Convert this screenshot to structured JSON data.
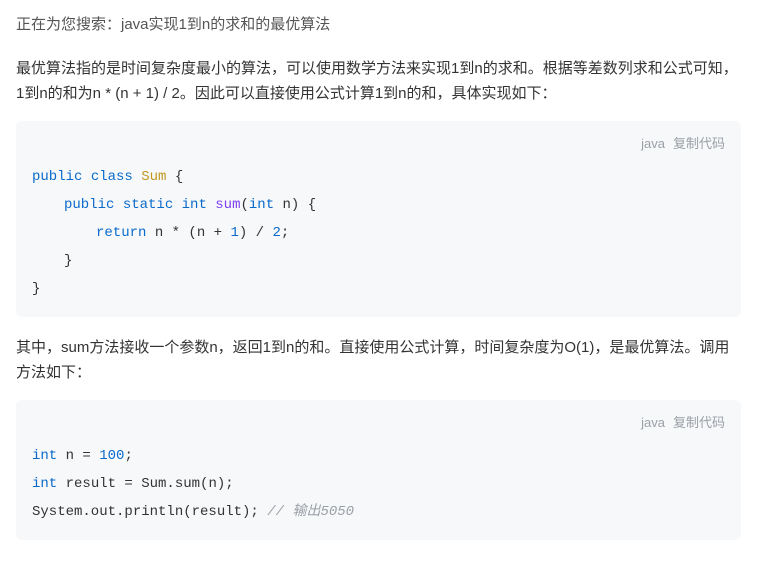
{
  "search_status": "正在为您搜索：java实现1到n的求和的最优算法",
  "para1": "最优算法指的是时间复杂度最小的算法，可以使用数学方法来实现1到n的求和。根据等差数列求和公式可知，1到n的和为n * (n + 1) / 2。因此可以直接使用公式计算1到n的和，具体实现如下：",
  "code1": {
    "lang": "java",
    "copy_label": "复制代码",
    "tokens": {
      "kw_public1": "public",
      "kw_class": "class",
      "cls_sum": "Sum",
      "brace_open1": " {",
      "kw_public2": "public",
      "kw_static": "static",
      "kw_int1": "int",
      "fn_sum": "sum",
      "paren_open": "(",
      "kw_int2": "int",
      "param_n": " n) {",
      "kw_return": "return",
      "expr_part1": " n * (n + ",
      "num1": "1",
      "expr_part2": ") / ",
      "num2": "2",
      "semi1": ";",
      "brace_close_inner": "}",
      "brace_close_outer": "}"
    }
  },
  "para2": "其中，sum方法接收一个参数n，返回1到n的和。直接使用公式计算，时间复杂度为O(1)，是最优算法。调用方法如下：",
  "code2": {
    "lang": "java",
    "copy_label": "复制代码",
    "tokens": {
      "kw_int1": "int",
      "line1_rest": " n = ",
      "num100": "100",
      "semi1": ";",
      "kw_int2": "int",
      "line2_rest": " result = Sum.sum(n);",
      "line3_text": "System.out.println(result); ",
      "comment": "// 输出5050"
    }
  }
}
